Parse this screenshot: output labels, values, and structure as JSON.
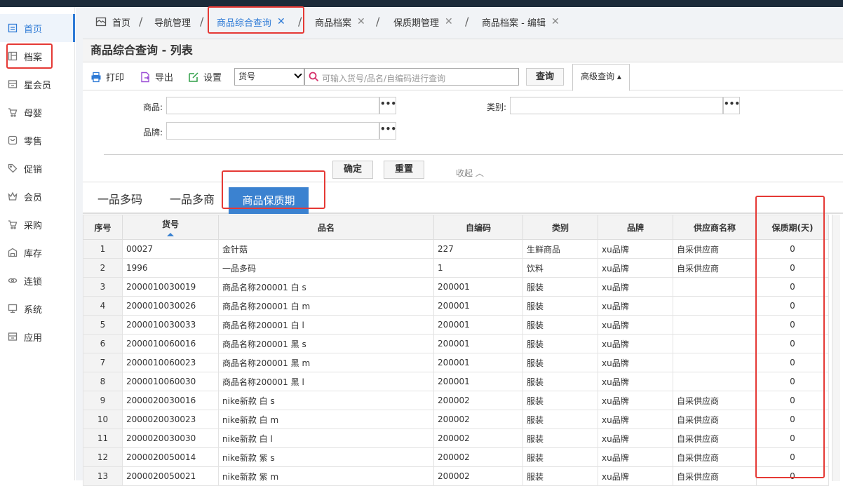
{
  "sidebar": {
    "items": [
      {
        "label": "首页",
        "icon": "home-icon"
      },
      {
        "label": "档案",
        "icon": "archive-icon"
      },
      {
        "label": "星会员",
        "icon": "star-member-icon"
      },
      {
        "label": "母婴",
        "icon": "cart-icon"
      },
      {
        "label": "零售",
        "icon": "bag-icon"
      },
      {
        "label": "促销",
        "icon": "tag-icon"
      },
      {
        "label": "会员",
        "icon": "crown-icon"
      },
      {
        "label": "采购",
        "icon": "cart-icon"
      },
      {
        "label": "库存",
        "icon": "warehouse-icon"
      },
      {
        "label": "连锁",
        "icon": "link-icon"
      },
      {
        "label": "系统",
        "icon": "monitor-icon"
      },
      {
        "label": "应用",
        "icon": "apps-icon"
      }
    ]
  },
  "tabs": {
    "home": "首页",
    "items": [
      "导航管理",
      "商品综合查询",
      "商品档案",
      "保质期管理",
      "商品档案 - 编辑"
    ]
  },
  "page": {
    "title": "商品综合查询 - 列表"
  },
  "toolbar": {
    "print": "打印",
    "export": "导出",
    "settings": "设置",
    "select_value": "货号",
    "search_placeholder": "可输入货号/品名/自编码进行查询",
    "query": "查询",
    "advanced": "高级查询 ▴"
  },
  "filter": {
    "product_label": "商品:",
    "category_label": "类别:",
    "brand_label": "品牌:",
    "dots": "•••",
    "confirm": "确定",
    "reset": "重置",
    "collapse": "收起 ︿"
  },
  "subtabs": [
    "一品多码",
    "一品多商",
    "商品保质期"
  ],
  "table": {
    "headers": [
      "序号",
      "货号",
      "品名",
      "自编码",
      "类别",
      "品牌",
      "供应商名称",
      "保质期(天)"
    ],
    "rows": [
      [
        "1",
        "00027",
        "金针菇",
        "227",
        "生鲜商品",
        "xu品牌",
        "自采供应商",
        "0"
      ],
      [
        "2",
        "1996",
        "一品多码",
        "1",
        "饮料",
        "xu品牌",
        "自采供应商",
        "0"
      ],
      [
        "3",
        "2000010030019",
        "商品名称200001 白 s",
        "200001",
        "服装",
        "xu品牌",
        "",
        "0"
      ],
      [
        "4",
        "2000010030026",
        "商品名称200001 白 m",
        "200001",
        "服装",
        "xu品牌",
        "",
        "0"
      ],
      [
        "5",
        "2000010030033",
        "商品名称200001 白 l",
        "200001",
        "服装",
        "xu品牌",
        "",
        "0"
      ],
      [
        "6",
        "2000010060016",
        "商品名称200001 黑 s",
        "200001",
        "服装",
        "xu品牌",
        "",
        "0"
      ],
      [
        "7",
        "2000010060023",
        "商品名称200001 黑 m",
        "200001",
        "服装",
        "xu品牌",
        "",
        "0"
      ],
      [
        "8",
        "2000010060030",
        "商品名称200001 黑 l",
        "200001",
        "服装",
        "xu品牌",
        "",
        "0"
      ],
      [
        "9",
        "2000020030016",
        "nike新款 白 s",
        "200002",
        "服装",
        "xu品牌",
        "自采供应商",
        "0"
      ],
      [
        "10",
        "2000020030023",
        "nike新款 白 m",
        "200002",
        "服装",
        "xu品牌",
        "自采供应商",
        "0"
      ],
      [
        "11",
        "2000020030030",
        "nike新款 白 l",
        "200002",
        "服装",
        "xu品牌",
        "自采供应商",
        "0"
      ],
      [
        "12",
        "2000020050014",
        "nike新款 紫 s",
        "200002",
        "服装",
        "xu品牌",
        "自采供应商",
        "0"
      ],
      [
        "13",
        "2000020050021",
        "nike新款 紫 m",
        "200002",
        "服装",
        "xu品牌",
        "自采供应商",
        "0"
      ]
    ]
  },
  "colors": {
    "accent": "#2f7bd6",
    "highlight": "#e53935",
    "active_subtab": "#3b82d0"
  }
}
